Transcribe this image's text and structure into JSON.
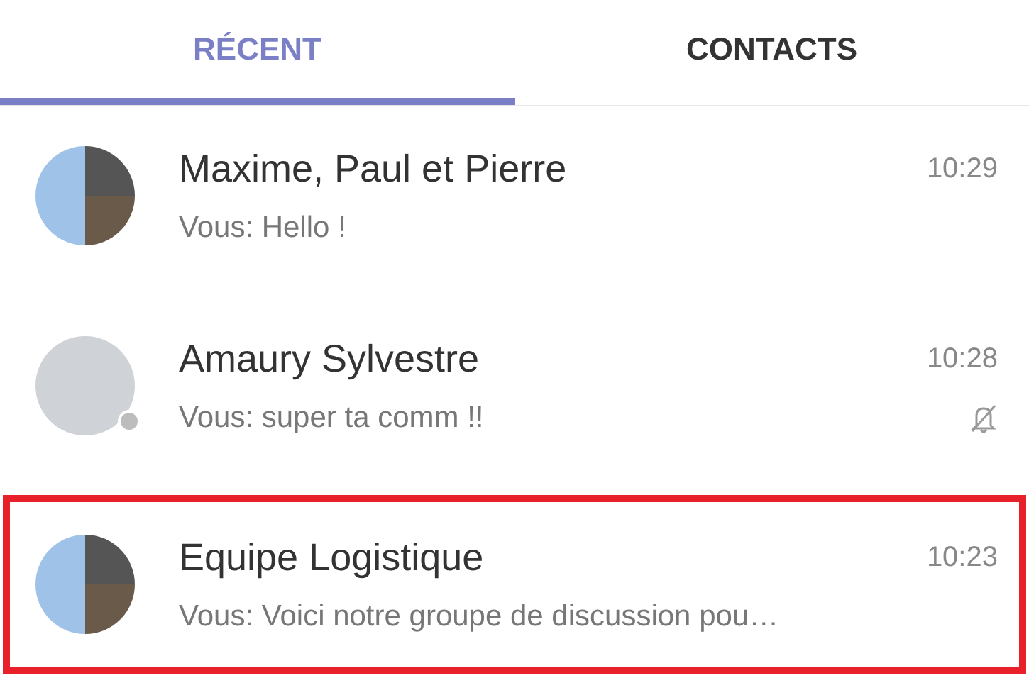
{
  "tabs": [
    {
      "label": "RÉCENT",
      "selected": true
    },
    {
      "label": "CONTACTS",
      "selected": false
    }
  ],
  "conversations": [
    {
      "name": "Maxime, Paul et Pierre",
      "time": "10:29",
      "preview": "Vous: Hello !",
      "kind": "group",
      "presence": false,
      "muted": false,
      "highlighted": false
    },
    {
      "name": "Amaury Sylvestre",
      "time": "10:28",
      "preview": "Vous: super ta comm !!",
      "kind": "single",
      "presence": true,
      "muted": true,
      "highlighted": false
    },
    {
      "name": "Equipe Logistique",
      "time": "10:23",
      "preview": "Vous: Voici notre groupe de discussion pou…",
      "kind": "group",
      "presence": false,
      "muted": false,
      "highlighted": true
    }
  ]
}
